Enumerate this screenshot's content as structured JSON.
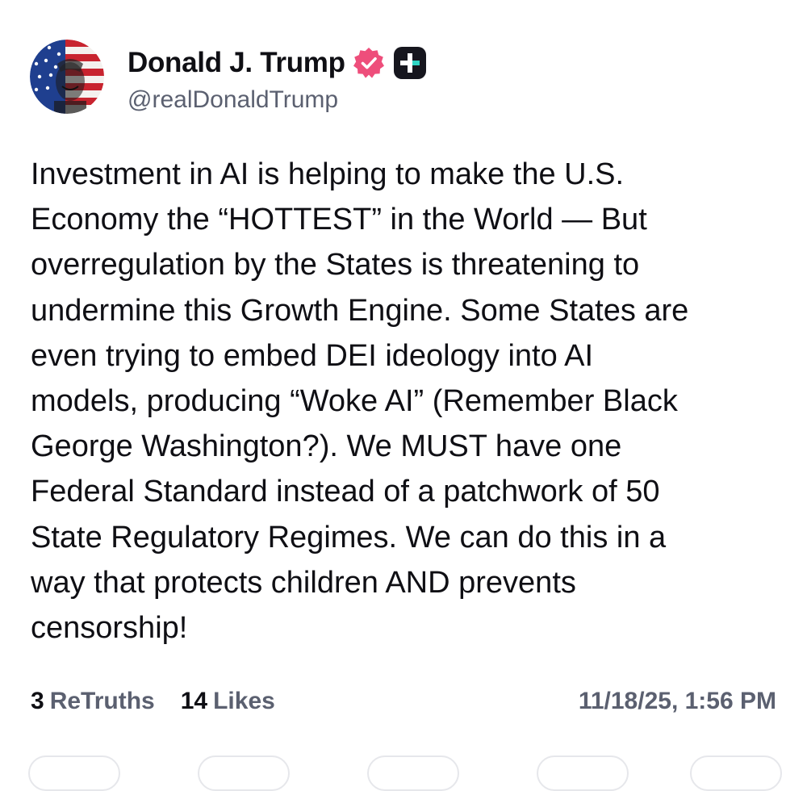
{
  "author": {
    "display_name": "Donald J. Trump",
    "handle": "@realDonaldTrump",
    "avatar_icon": "flag-portrait-avatar",
    "verified_icon": "verified-badge-icon",
    "verified_color": "#ee4e7b",
    "truth_plus_icon": "truth-plus-icon"
  },
  "post": {
    "text": "Investment in AI is helping to make the U.S.\nEconomy the “HOTTEST” in the World — But\noverregulation by the States is threatening to\nundermine this Growth Engine. Some States are\neven trying to embed DEI ideology into AI\nmodels, producing “Woke AI” (Remember Black\nGeorge Washington?). We MUST have one\nFederal Standard instead of a patchwork of 50\nState Regulatory Regimes. We can do this in a\nway that protects children AND prevents\ncensorship!"
  },
  "stats": {
    "retruths_count": "3",
    "retruths_label": "ReTruths",
    "likes_count": "14",
    "likes_label": "Likes",
    "timestamp": "11/18/25, 1:56 PM"
  },
  "colors": {
    "text": "#0f0f14",
    "muted": "#5b6070",
    "badge": "#ee4e7b"
  }
}
